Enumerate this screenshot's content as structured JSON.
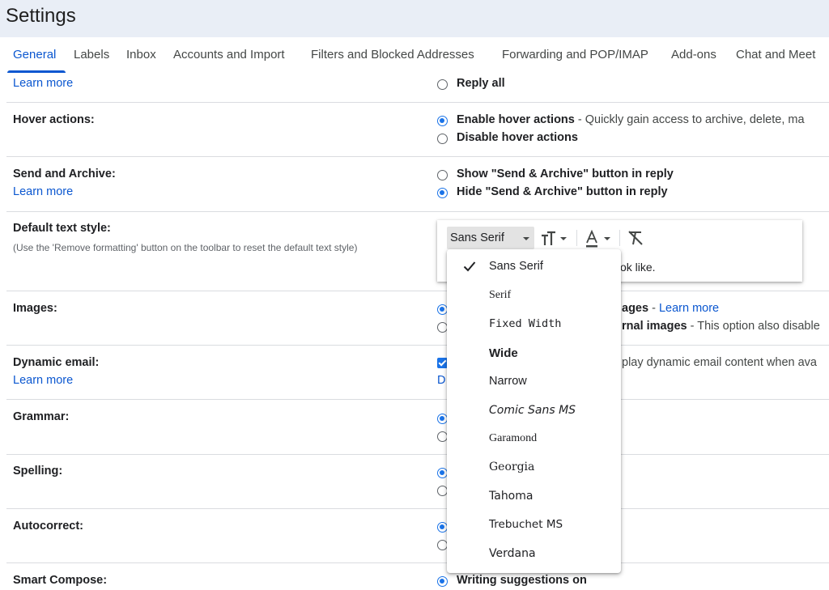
{
  "page": {
    "title": "Settings"
  },
  "tabs": [
    {
      "label": "General",
      "active": true
    },
    {
      "label": "Labels"
    },
    {
      "label": "Inbox"
    },
    {
      "label": "Accounts and Import"
    },
    {
      "label": "Filters and Blocked Addresses"
    },
    {
      "label": "Forwarding and POP/IMAP"
    },
    {
      "label": "Add-ons"
    },
    {
      "label": "Chat and Meet"
    }
  ],
  "reply": {
    "learn_more": "Learn more",
    "reply_all": "Reply all"
  },
  "hover": {
    "label": "Hover actions:",
    "enable": "Enable hover actions",
    "enable_desc": " - Quickly gain access to archive, delete, ma",
    "disable": "Disable hover actions",
    "selected": "enable"
  },
  "send_archive": {
    "label": "Send and Archive:",
    "learn_more": "Learn more",
    "show": "Show \"Send & Archive\" button in reply",
    "hide": "Hide \"Send & Archive\" button in reply",
    "selected": "hide"
  },
  "text_style": {
    "label": "Default text style:",
    "help": "(Use the 'Remove formatting' button on the toolbar to reset the default text style)",
    "current_font": "Sans Serif",
    "preview_fragment": "ok like.",
    "toolbar_icons": [
      "font-size-icon",
      "text-color-icon",
      "remove-formatting-icon"
    ]
  },
  "images": {
    "label": "Images:",
    "opt1_fragment": "ages",
    "opt1_sep": " - ",
    "learn_more": "Learn more",
    "opt2_fragment": "rnal images",
    "opt2_desc": " - This option also disable"
  },
  "dynamic": {
    "label": "Dynamic email:",
    "learn_more": "Learn more",
    "desc_fragment": "play dynamic email content when ava",
    "link_fragment": "D"
  },
  "grammar": {
    "label": "Grammar:"
  },
  "spelling": {
    "label": "Spelling:"
  },
  "autocorrect": {
    "label": "Autocorrect:"
  },
  "smart_compose": {
    "label": "Smart Compose:",
    "option": "Writing suggestions on"
  },
  "font_menu": {
    "selected": "Sans Serif",
    "items": [
      "Sans Serif",
      "Serif",
      "Fixed Width",
      "Wide",
      "Narrow",
      "Comic Sans MS",
      "Garamond",
      "Georgia",
      "Tahoma",
      "Trebuchet MS",
      "Verdana"
    ]
  },
  "colors": {
    "accent": "#0b57d0",
    "radio": "#1a73e8",
    "header_bg": "#e9eef6"
  }
}
